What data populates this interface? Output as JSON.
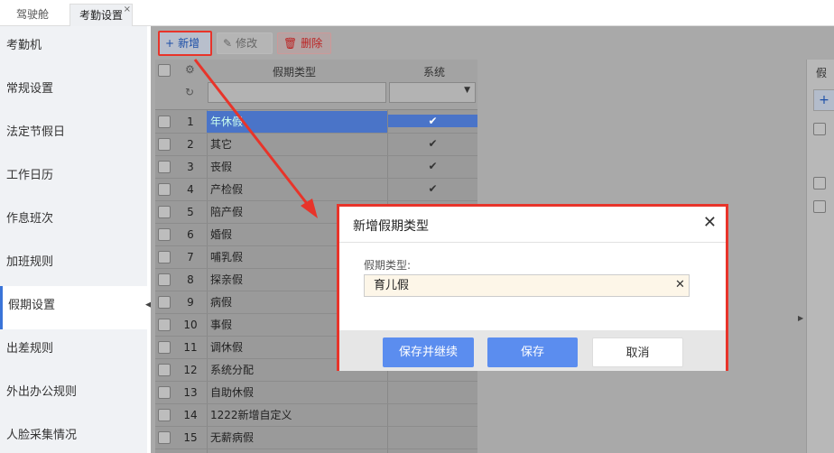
{
  "tabs": [
    {
      "label": "驾驶舱"
    },
    {
      "label": "考勤设置",
      "close": "×"
    }
  ],
  "sidebar": {
    "items": [
      {
        "label": "考勤机"
      },
      {
        "label": "常规设置"
      },
      {
        "label": "法定节假日"
      },
      {
        "label": "工作日历"
      },
      {
        "label": "作息班次"
      },
      {
        "label": "加班规则"
      },
      {
        "label": "假期设置",
        "active": true
      },
      {
        "label": "出差规则"
      },
      {
        "label": "外出办公规则"
      },
      {
        "label": "人脸采集情况"
      }
    ]
  },
  "toolbar": {
    "add_label": "新增",
    "edit_label": "修改",
    "delete_label": "删除"
  },
  "grid": {
    "columns": [
      "假期类型",
      "系统"
    ],
    "rows": [
      {
        "num": "1",
        "name": "年休假",
        "system": "✔",
        "selected": true
      },
      {
        "num": "2",
        "name": "其它",
        "system": "✔"
      },
      {
        "num": "3",
        "name": "丧假",
        "system": "✔"
      },
      {
        "num": "4",
        "name": "产检假",
        "system": "✔"
      },
      {
        "num": "5",
        "name": "陪产假",
        "system": ""
      },
      {
        "num": "6",
        "name": "婚假",
        "system": ""
      },
      {
        "num": "7",
        "name": "哺乳假",
        "system": ""
      },
      {
        "num": "8",
        "name": "探亲假",
        "system": ""
      },
      {
        "num": "9",
        "name": "病假",
        "system": ""
      },
      {
        "num": "10",
        "name": "事假",
        "system": ""
      },
      {
        "num": "11",
        "name": "调休假",
        "system": ""
      },
      {
        "num": "12",
        "name": "系统分配",
        "system": ""
      },
      {
        "num": "13",
        "name": "自助休假",
        "system": ""
      },
      {
        "num": "14",
        "name": "1222新增自定义",
        "system": ""
      },
      {
        "num": "15",
        "name": "无薪病假",
        "system": ""
      }
    ]
  },
  "right_panel": {
    "tab_label": "假"
  },
  "dialog": {
    "title": "新增假期类型",
    "field_label": "假期类型:",
    "field_value": "育儿假",
    "save_continue_label": "保存并继续",
    "save_label": "保存",
    "cancel_label": "取消"
  },
  "colors": {
    "accent": "#5b8def",
    "highlight": "#e8342a",
    "selected_row": "#4a74c8"
  }
}
